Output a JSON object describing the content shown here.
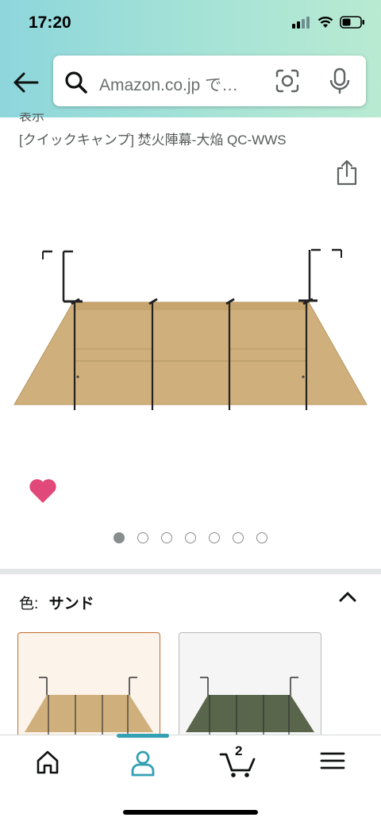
{
  "status_bar": {
    "time": "17:20",
    "icons": [
      "cellular-signal-icon",
      "wifi-icon",
      "battery-icon"
    ]
  },
  "header": {
    "back_icon": "back-arrow-icon",
    "search": {
      "text": "Amazon.co.jp で…",
      "icons": [
        "search-icon",
        "camera-scan-icon",
        "microphone-icon"
      ]
    }
  },
  "product": {
    "truncated_line": "表示",
    "title": "[クイックキャンプ] 焚火陣幕-大焔 QC-WWS",
    "share_icon": "share-icon",
    "wishlist_icon": "heart-icon",
    "image_carousel": {
      "total": 7,
      "active_index": 0
    }
  },
  "variation": {
    "label": "色:",
    "value": "サンド",
    "options": [
      {
        "name": "sand",
        "color": "#cfb07c",
        "selected": true
      },
      {
        "name": "olive",
        "color": "#59664c",
        "selected": false
      }
    ]
  },
  "bottom_nav": {
    "active": "account",
    "cart_count": "2",
    "items": [
      "home-icon",
      "account-icon",
      "cart-icon",
      "menu-icon"
    ]
  },
  "colors": {
    "header_gradient_start": "#8dd6dc",
    "header_gradient_end": "#b9ead2",
    "active_nav": "#34a0b3",
    "heart": "#e0497a",
    "tent_sand": "#cfb07c"
  }
}
